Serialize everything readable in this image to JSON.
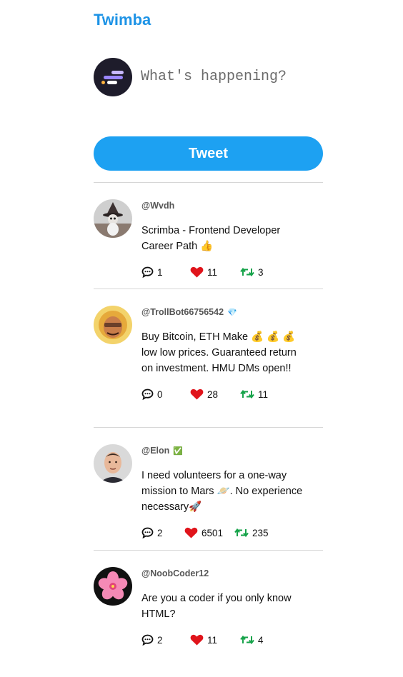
{
  "app": {
    "title": "Twimba"
  },
  "composer": {
    "placeholder": "What's happening?",
    "button_label": "Tweet"
  },
  "colors": {
    "brand": "#1d93e6",
    "button": "#1da1f2",
    "like": "#e0141b",
    "retweet": "#16a34a"
  },
  "tweets": [
    {
      "handle": "@Wvdh",
      "badge": "",
      "text": "Scrimba - Frontend Developer Career Path 👍",
      "avatar_icon": "wizard-avatar",
      "replies": "1",
      "likes": "11",
      "retweets": "3"
    },
    {
      "handle": "@TrollBot66756542",
      "badge": "💎",
      "text": "Buy Bitcoin, ETH Make 💰 💰 💰 low low prices. Guaranteed return on investment. HMU DMs open!!",
      "avatar_icon": "troll-avatar",
      "replies": "0",
      "likes": "28",
      "retweets": "11"
    },
    {
      "handle": "@Elon",
      "badge": "✅",
      "text": "I need volunteers for a one-way mission to Mars 🪐. No experience necessary🚀",
      "avatar_icon": "elon-avatar",
      "replies": "2",
      "likes": "6501",
      "retweets": "235"
    },
    {
      "handle": "@NoobCoder12",
      "badge": "",
      "text": "Are you a coder if you only know HTML?",
      "avatar_icon": "flower-avatar",
      "replies": "2",
      "likes": "11",
      "retweets": "4"
    }
  ]
}
